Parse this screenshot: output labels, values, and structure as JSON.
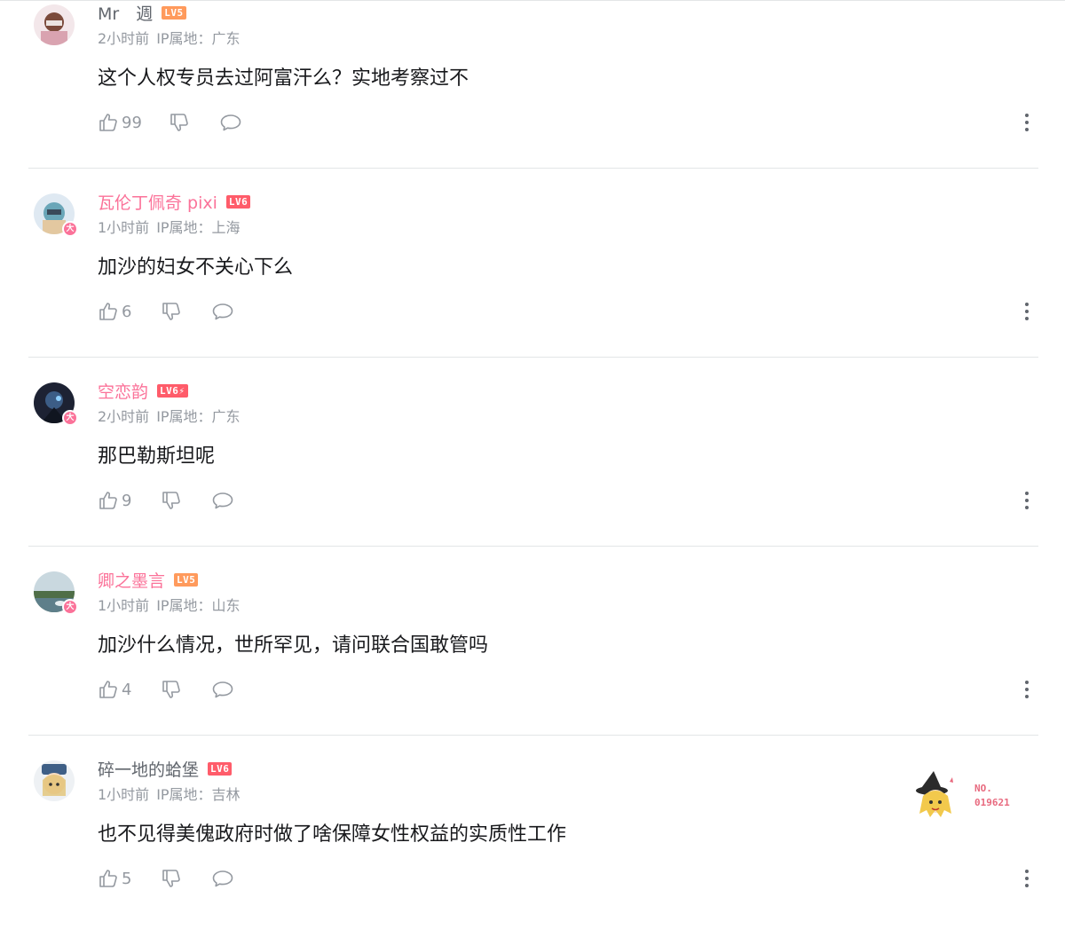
{
  "comments": [
    {
      "username": "Mr　週",
      "level": "LV5",
      "time": "2小时前",
      "ip": "IP属地：广东",
      "content": "这个人权专员去过阿富汗么？实地考察过不",
      "likes": "99"
    },
    {
      "username": "瓦伦丁佩奇 pixi",
      "level": "LV6",
      "vip_badge": "大",
      "time": "1小时前",
      "ip": "IP属地：上海",
      "content": "加沙的妇女不关心下么",
      "likes": "6"
    },
    {
      "username": "空恋韵",
      "level": "LV6",
      "level_suffix": "⚡",
      "vip_badge": "大",
      "time": "2小时前",
      "ip": "IP属地：广东",
      "content": "那巴勒斯坦呢",
      "likes": "9"
    },
    {
      "username": "卿之墨言",
      "level": "LV5",
      "vip_badge": "大",
      "time": "1小时前",
      "ip": "IP属地：山东",
      "content": "加沙什么情况，世所罕见，请问联合国敢管吗",
      "likes": "4"
    },
    {
      "username": "碎一地的蛤堡",
      "level": "LV6",
      "time": "1小时前",
      "ip": "IP属地：吉林",
      "content": "也不见得美傀政府时做了啥保障女性权益的实质性工作",
      "likes": "5",
      "fan_badge_no": "NO.\n019621"
    }
  ],
  "icons": {
    "like": "thumbs-up-icon",
    "dislike": "thumbs-down-icon",
    "reply": "speech-bubble-icon",
    "more": "vertical-ellipsis-icon"
  },
  "colors": {
    "pink_username": "#fb7299",
    "gray_username": "#61666d",
    "meta_text": "#9499a0",
    "lv5": "#ff9a5c",
    "lv6": "#ff5c6a",
    "divider": "#e3e5e7"
  }
}
